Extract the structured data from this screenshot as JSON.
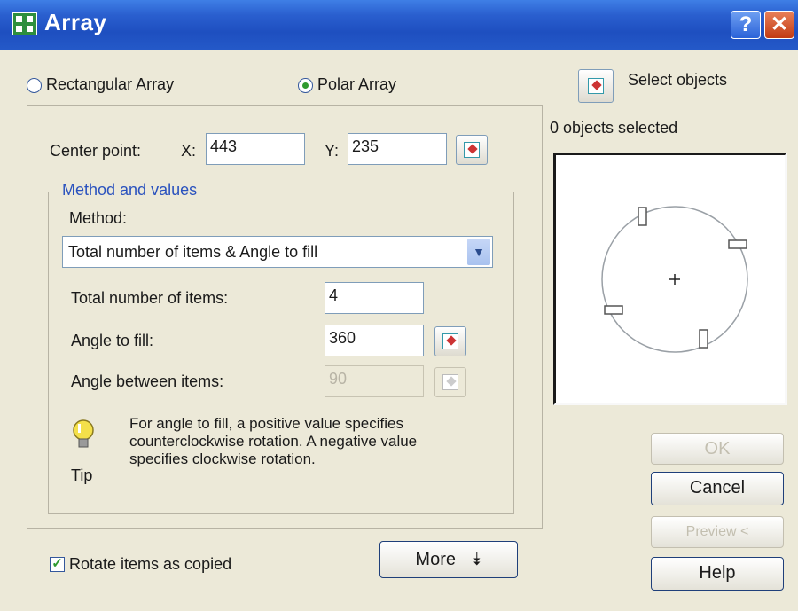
{
  "window": {
    "title": "Array",
    "help_label": "?",
    "close_label": "✕"
  },
  "mode": {
    "rectangular_label": "Rectangular Array",
    "polar_label": "Polar Array",
    "selected": "Polar Array"
  },
  "selection": {
    "select_objects_label": "Select objects",
    "status": "0 objects selected"
  },
  "center_point": {
    "label": "Center point:",
    "x_label": "X:",
    "x_value": "443",
    "y_label": "Y:",
    "y_value": "235"
  },
  "method_group": {
    "title": "Method and values",
    "method_label": "Method:",
    "method_value": "Total number of items & Angle to fill",
    "total_items_label": "Total number of items:",
    "total_items_value": "4",
    "angle_fill_label": "Angle to fill:",
    "angle_fill_value": "360",
    "angle_between_label": "Angle between items:",
    "angle_between_value": "90"
  },
  "tip": {
    "label": "Tip",
    "text": "For angle to fill, a positive value specifies counterclockwise rotation.  A negative value specifies clockwise rotation."
  },
  "rotate_items": {
    "label": "Rotate items as copied",
    "checked": true
  },
  "buttons": {
    "more": "More",
    "ok": "OK",
    "cancel": "Cancel",
    "preview": "Preview <",
    "help": "Help"
  },
  "icons": [
    "array-app-icon",
    "help-icon",
    "close-icon",
    "pick-point-icon",
    "select-objects-icon",
    "dropdown-arrow-icon",
    "tip-lightbulb-icon",
    "more-chevron-icon",
    "checkmark-icon"
  ],
  "colors": {
    "titlebar": "#245dd7",
    "dialog_bg": "#ece9d8",
    "accent_green": "#2f9a2f",
    "close_red": "#c23a12"
  }
}
